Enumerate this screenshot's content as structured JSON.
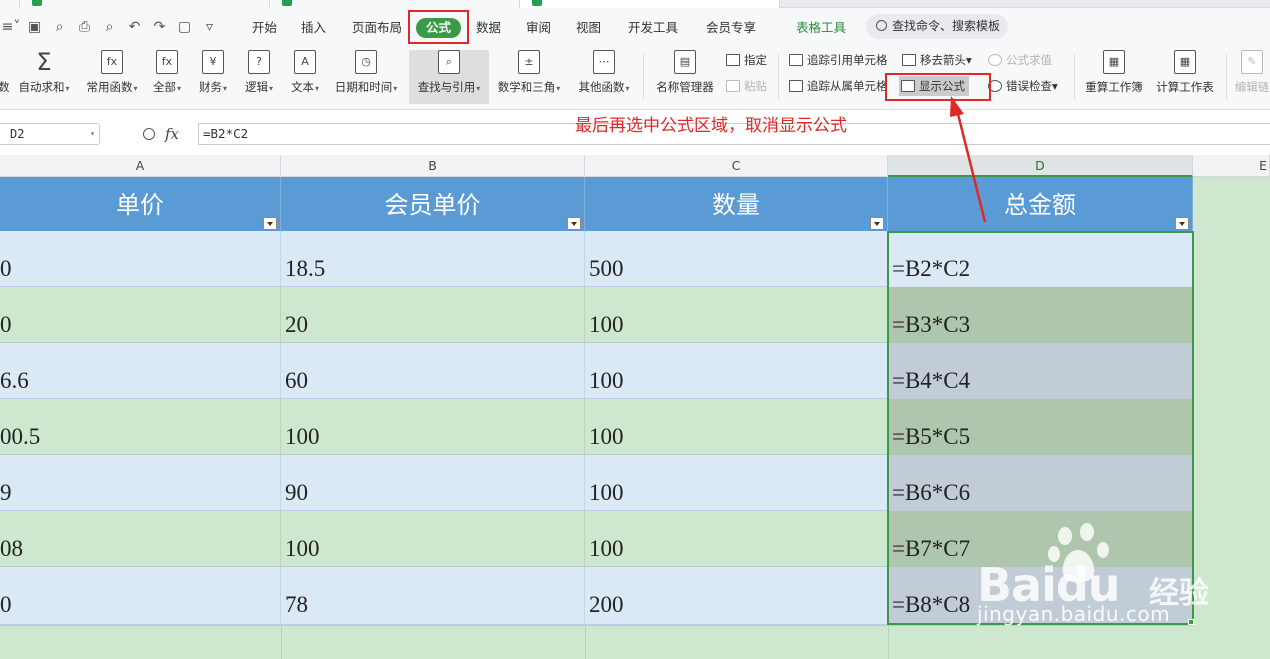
{
  "menubar": {
    "items": [
      "开始",
      "插入",
      "页面布局",
      "公式",
      "数据",
      "审阅",
      "视图",
      "开发工具",
      "会员专享"
    ],
    "table_tools": "表格工具",
    "search_placeholder": "查找命令、搜索模板"
  },
  "ribbon": {
    "autosum": "自动求和",
    "common_functions": "常用函数",
    "all": "全部",
    "finance": "财务",
    "logic": "逻辑",
    "text": "文本",
    "datetime": "日期和时间",
    "lookup": "查找与引用",
    "math": "数学和三角",
    "other_functions": "其他函数",
    "name_manager": "名称管理器",
    "define": "指定",
    "paste": "粘贴",
    "trace_precedents": "追踪引用单元格",
    "trace_dependents": "追踪从属单元格",
    "remove_arrows": "移去箭头",
    "evaluate_formula": "公式求值",
    "show_formulas": "显示公式",
    "error_check": "错误检查",
    "recalc_workbook": "重算工作簿",
    "calc_sheet": "计算工作表",
    "edit_links": "编辑链"
  },
  "formula_bar": {
    "name_box": "D2",
    "fx_label": "fx",
    "formula": "=B2*C2"
  },
  "annotation": "最后再选中公式区域，取消显示公式",
  "columns": [
    "A",
    "B",
    "C",
    "D",
    "E"
  ],
  "table": {
    "headers": [
      "单价",
      "会员单价",
      "数量",
      "总金额"
    ],
    "rows": [
      [
        "0",
        "18.5",
        "500",
        "=B2*C2"
      ],
      [
        "0",
        "20",
        "100",
        "=B3*C3"
      ],
      [
        "6.6",
        "60",
        "100",
        "=B4*C4"
      ],
      [
        "00.5",
        "100",
        "100",
        "=B5*C5"
      ],
      [
        "9",
        "90",
        "100",
        "=B6*C6"
      ],
      [
        "08",
        "100",
        "100",
        "=B7*C7"
      ],
      [
        "0",
        "78",
        "200",
        "=B8*C8"
      ]
    ]
  },
  "watermark": {
    "logo": "Baidu",
    "cn": "经验",
    "url": "jingyan.baidu.com"
  },
  "colors": {
    "header_fill": "#5b9bd5",
    "band_blue": "#dbe8f6",
    "band_green": "#cde8cf",
    "selection": "#3a9a48",
    "annotation": "#e02828"
  }
}
